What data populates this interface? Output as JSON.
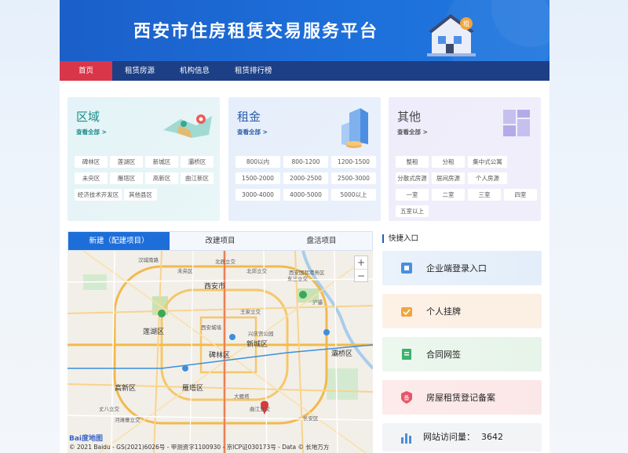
{
  "header": {
    "title": "西安市住房租赁交易服务平台"
  },
  "nav": {
    "items": [
      {
        "label": "首页",
        "active": true
      },
      {
        "label": "租赁房源",
        "active": false
      },
      {
        "label": "机构信息",
        "active": false
      },
      {
        "label": "租赁排行榜",
        "active": false
      }
    ]
  },
  "filters": {
    "region": {
      "title": "区域",
      "more": "查看全部 >",
      "tags": [
        "碑林区",
        "莲湖区",
        "新城区",
        "灞桥区",
        "未央区",
        "雁塔区",
        "高新区",
        "曲江新区",
        "经济技术开发区",
        "其他县区"
      ]
    },
    "rent": {
      "title": "租金",
      "more": "查看全部 >",
      "tags": [
        "800以内",
        "800-1200",
        "1200-1500",
        "1500-2000",
        "2000-2500",
        "2500-3000",
        "3000-4000",
        "4000-5000",
        "5000以上"
      ]
    },
    "other": {
      "title": "其他",
      "more": "查看全部 >",
      "tags": [
        "整租",
        "分租",
        "集中式公寓",
        "分散式房源",
        "居间房源",
        "个人房源",
        "一室",
        "二室",
        "三室",
        "四室",
        "五室以上"
      ]
    }
  },
  "map": {
    "tabs": [
      {
        "label": "新建（配建项目）",
        "active": true
      },
      {
        "label": "改建项目",
        "active": false
      },
      {
        "label": "盘活项目",
        "active": false
      }
    ],
    "labels": {
      "city": "西安市",
      "beichen": "北辰立交",
      "hanchengnan": "汉城南路",
      "weiyang": "未央区",
      "xianguoji": "西安国际港务区",
      "dongsan": "东三立交",
      "beiran": "北郊立交",
      "jiangong": "建工路",
      "xianyou": "西安市教育局",
      "chanhe": "浐灞",
      "wanghua": "王家立交",
      "baqiao": "灞桥区",
      "xiancheng": "西安城墙",
      "xingqing": "兴庆宫公园",
      "beilin": "碑林区",
      "yanta": "雁塔区",
      "dayanta": "大雁塔",
      "qujiang": "曲江立交",
      "gaoxin": "高新区",
      "lianhu": "莲湖区",
      "xinyuan": "新城区",
      "zhangba": "丈八立交",
      "heming": "河滩寨立交",
      "jiangong2": "长安区"
    },
    "copyright": "© 2021 Baidu - GS(2021)6026号 - 甲测资字1100930 - 京ICP证030173号 - Data © 长地万方",
    "logo": "Bai度地图"
  },
  "quick": {
    "title": "快捷入口",
    "items": [
      {
        "label": "企业端登录入口",
        "icon": "enterprise-login-icon",
        "color": "#4a8fe0"
      },
      {
        "label": "个人挂牌",
        "icon": "personal-listing-icon",
        "color": "#f0a53c"
      },
      {
        "label": "合同网签",
        "icon": "contract-sign-icon",
        "color": "#3bb36b"
      },
      {
        "label": "房屋租赁登记备案",
        "icon": "lease-registration-icon",
        "color": "#e6566a"
      }
    ],
    "visits": {
      "label": "网站访问量：",
      "value": "3642"
    }
  }
}
